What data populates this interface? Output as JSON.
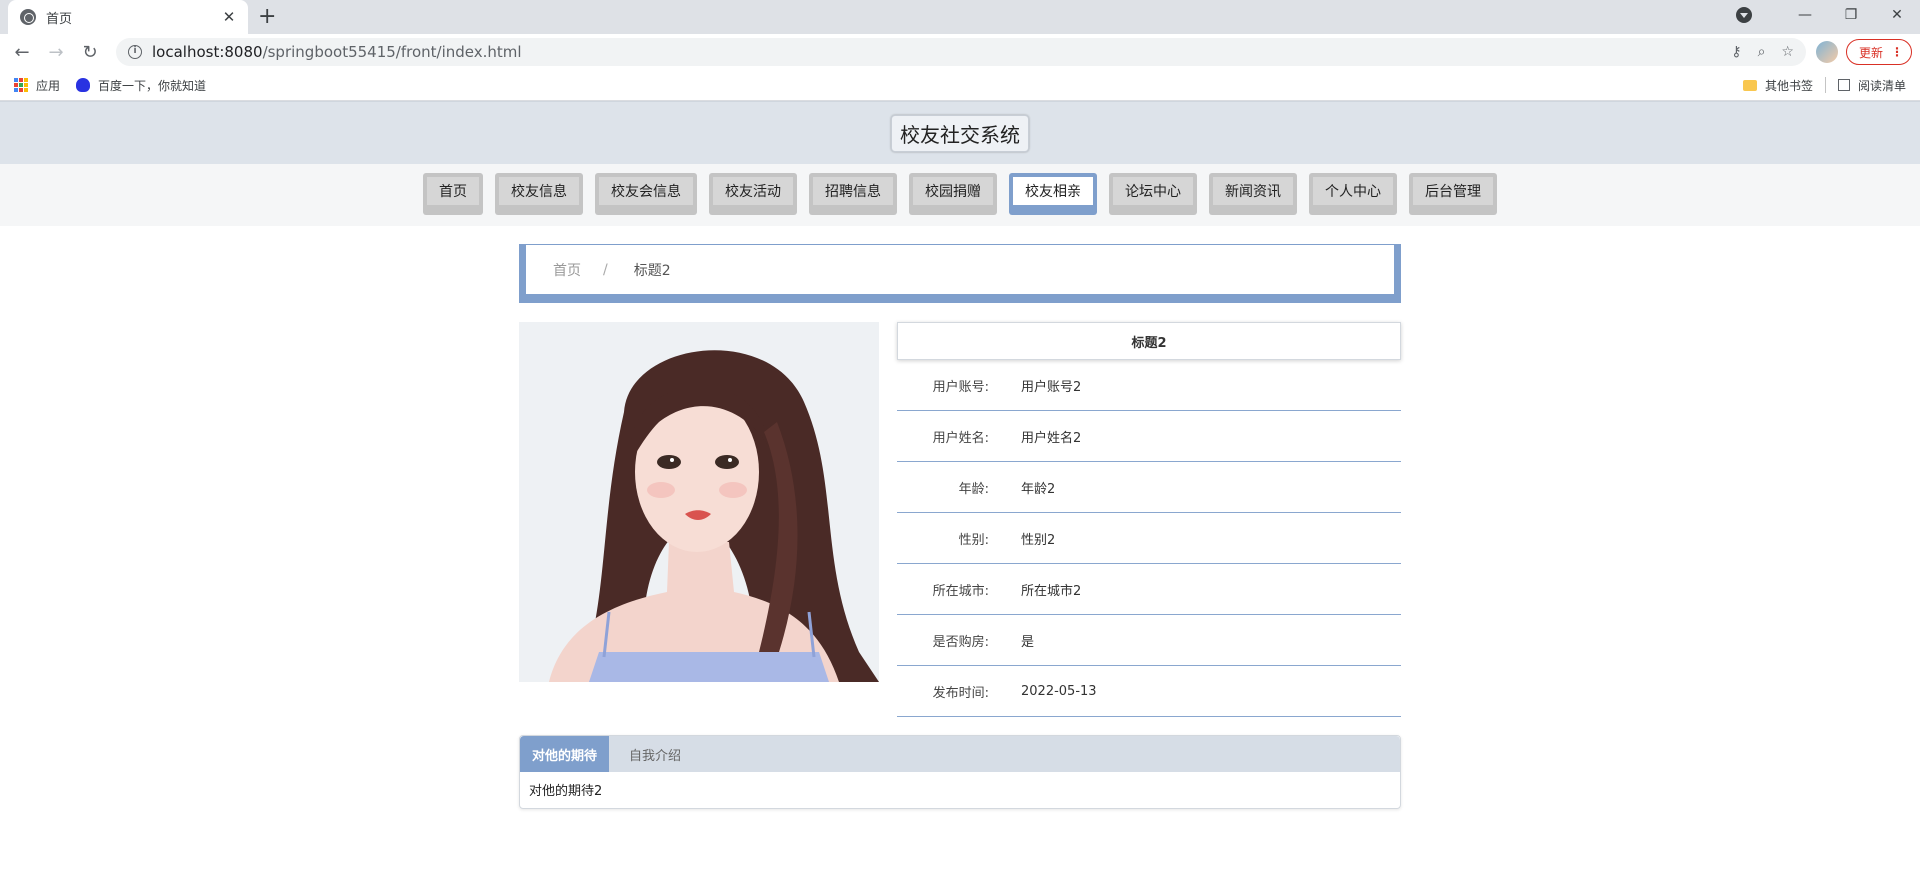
{
  "browser": {
    "tab_title": "首页",
    "url_host": "localhost:8080",
    "url_path": "/springboot55415/front/index.html",
    "update_label": "更新",
    "bookmarks": {
      "apps": "应用",
      "baidu": "百度一下，你就知道",
      "other": "其他书签",
      "reading": "阅读清单"
    }
  },
  "site": {
    "title": "校友社交系统",
    "nav": [
      "首页",
      "校友信息",
      "校友会信息",
      "校友活动",
      "招聘信息",
      "校园捐赠",
      "校友相亲",
      "论坛中心",
      "新闻资讯",
      "个人中心",
      "后台管理"
    ],
    "active_nav": "校友相亲"
  },
  "breadcrumb": {
    "home": "首页",
    "separator": "/",
    "current": "标题2"
  },
  "detail": {
    "title": "标题2",
    "fields": [
      {
        "label": "用户账号:",
        "value": "用户账号2"
      },
      {
        "label": "用户姓名:",
        "value": "用户姓名2"
      },
      {
        "label": "年龄:",
        "value": "年龄2"
      },
      {
        "label": "性别:",
        "value": "性别2"
      },
      {
        "label": "所在城市:",
        "value": "所在城市2"
      },
      {
        "label": "是否购房:",
        "value": "是"
      },
      {
        "label": "发布时间:",
        "value": "2022-05-13"
      }
    ]
  },
  "tabs": {
    "items": [
      "对他的期待",
      "自我介绍"
    ],
    "active_content": "对他的期待2"
  },
  "colors": {
    "accent": "#7f9fcc",
    "header_bg": "#dde3ea"
  }
}
